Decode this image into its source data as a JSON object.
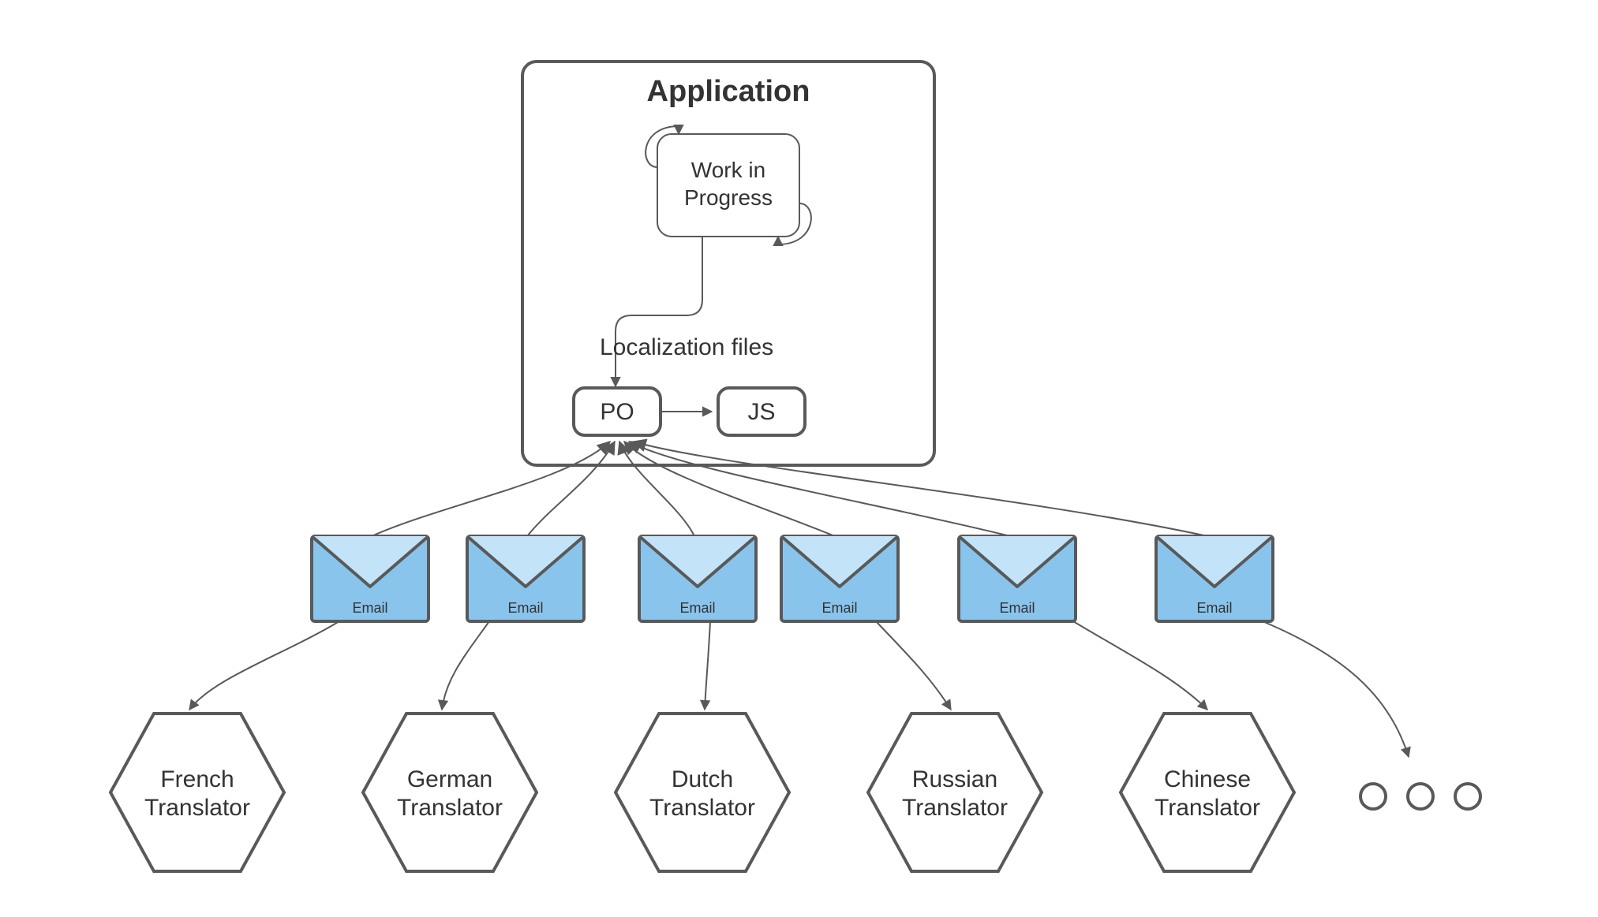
{
  "app": {
    "title": "Application",
    "wip_line1": "Work in",
    "wip_line2": "Progress",
    "loc_files_label": "Localization files",
    "po_label": "PO",
    "js_label": "JS"
  },
  "email_label": "Email",
  "translators": [
    {
      "line1": "French",
      "line2": "Translator"
    },
    {
      "line1": "German",
      "line2": "Translator"
    },
    {
      "line1": "Dutch",
      "line2": "Translator"
    },
    {
      "line1": "Russian",
      "line2": "Translator"
    },
    {
      "line1": "Chinese",
      "line2": "Translator"
    }
  ],
  "ellipsis_glyph": "○"
}
